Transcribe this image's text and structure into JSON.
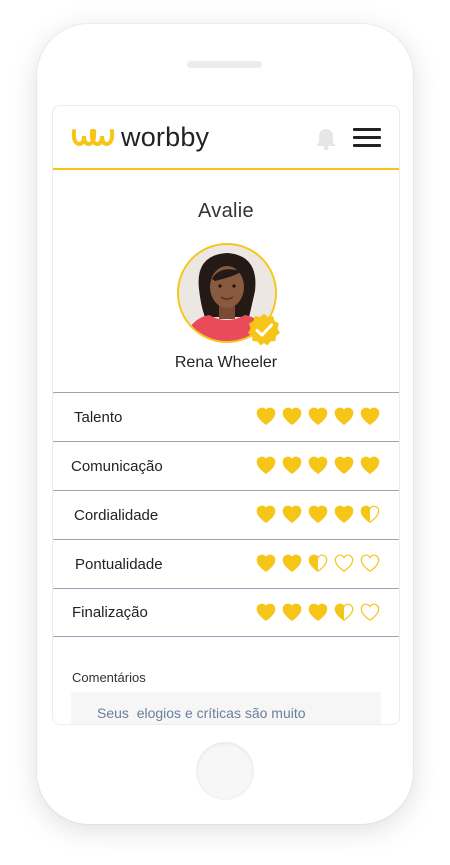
{
  "header": {
    "brand_name": "worbby",
    "brand_color": "#f5c518",
    "icons": [
      "worbby-logo",
      "bell-icon",
      "menu-icon"
    ]
  },
  "page": {
    "title": "Avalie"
  },
  "profile": {
    "name": "Rena Wheeler",
    "verified": true
  },
  "ratings": {
    "max": 5,
    "items": [
      {
        "label": "Talento",
        "value": 5
      },
      {
        "label": "Comunicação",
        "value": 5
      },
      {
        "label": "Cordialidade",
        "value": 4.5
      },
      {
        "label": "Pontualidade",
        "value": 2.5
      },
      {
        "label": "Finalização",
        "value": 3.5
      }
    ]
  },
  "comments": {
    "label": "Comentários",
    "placeholder": "Seus  elogios e críticas são muito importantes"
  },
  "colors": {
    "accent": "#f5c518",
    "divider": "#97a7ba",
    "placeholder_text": "#6a7f99"
  }
}
